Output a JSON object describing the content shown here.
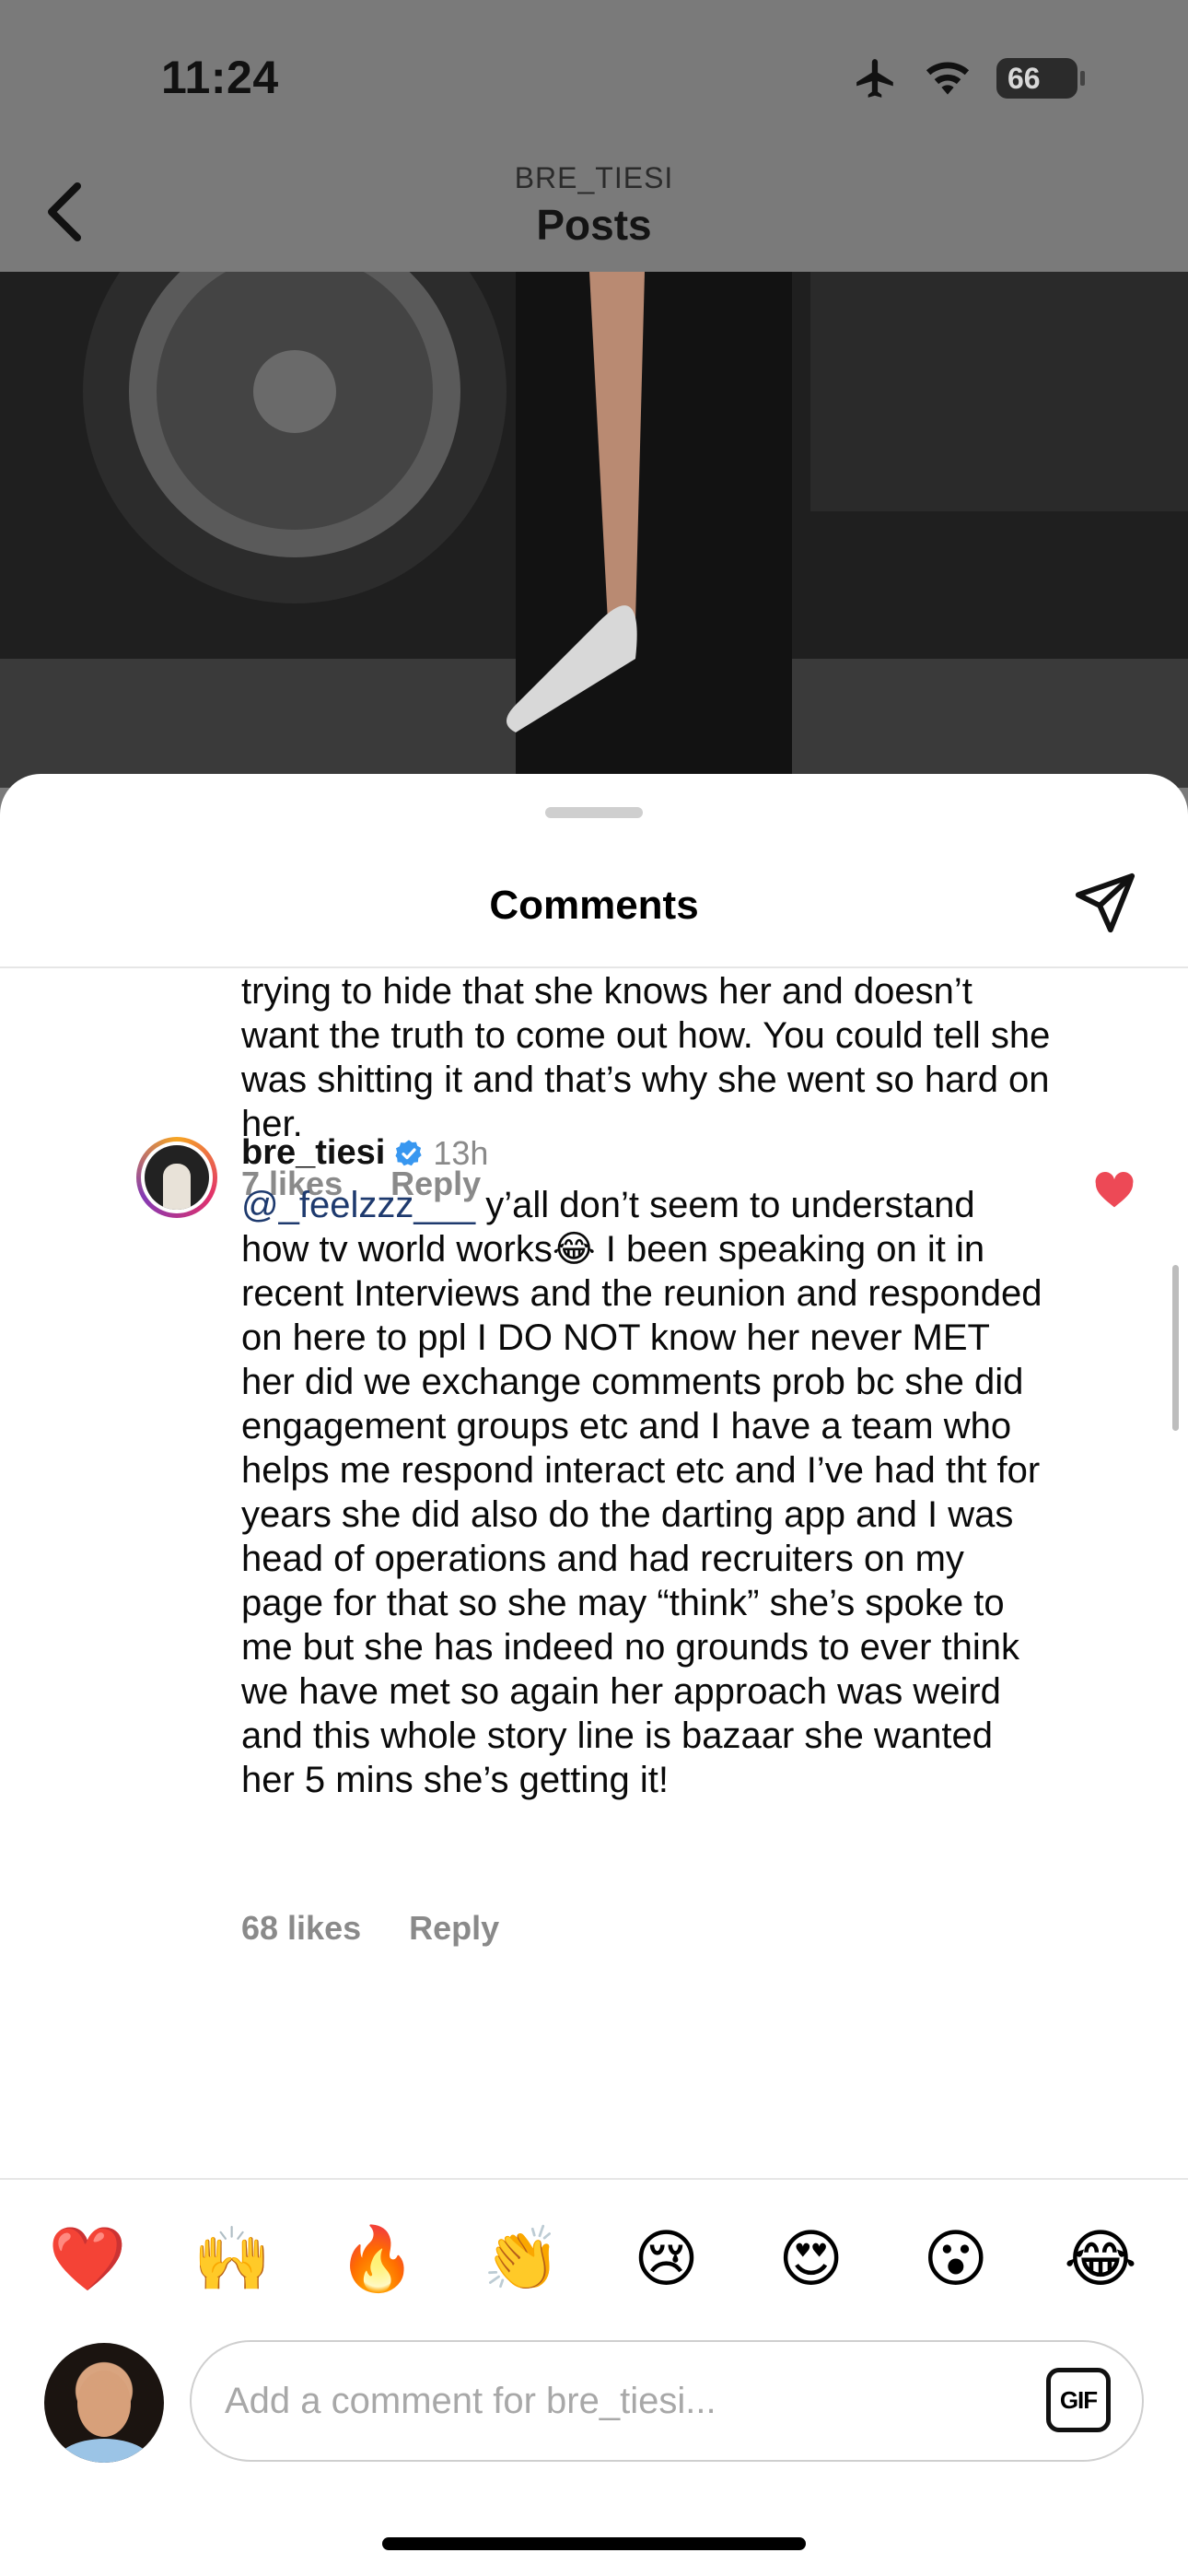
{
  "status_bar": {
    "time": "11:24",
    "battery": "66",
    "icons": [
      "airplane-icon",
      "wifi-icon",
      "battery-icon"
    ]
  },
  "post_header": {
    "username": "BRE_TIESI",
    "title": "Posts"
  },
  "sheet": {
    "title": "Comments"
  },
  "comments": [
    {
      "text": "trying to hide that she knows her and doesn’t want the truth to come out how. You could tell she was shitting it and that’s why she went so hard on her.",
      "likes": "7 likes",
      "reply": "Reply"
    },
    {
      "username": "bre_tiesi",
      "verified": true,
      "time": "13h",
      "mention": "@_feelzzz___",
      "text": " y’all don’t seem to understand how tv world works😂 I been speaking on it in recent Interviews  and the reunion and responded on here to ppl I DO NOT know her never MET her did we exchange comments prob bc she did engagement groups etc and I have a team who helps me respond interact etc and I’ve had tht for years she did also  do the darting app and I was head of operations and had recruiters on my page for that so she may “think” she’s spoke to me but she has indeed no grounds to ever think we have met so again her approach was weird and this whole story line is bazaar she wanted her 5 mins she’s getting it!",
      "likes": "68 likes",
      "reply": "Reply",
      "liked": true
    }
  ],
  "emoji_bar": [
    "❤️",
    "🙌",
    "🔥",
    "👏",
    "😢",
    "😍",
    "😮",
    "😂"
  ],
  "composer": {
    "placeholder": "Add a comment for bre_tiesi...",
    "gif_label": "GIF"
  },
  "colors": {
    "mention": "#1e3a6e",
    "like_red": "#ed4956",
    "verified_blue": "#3897f0"
  }
}
